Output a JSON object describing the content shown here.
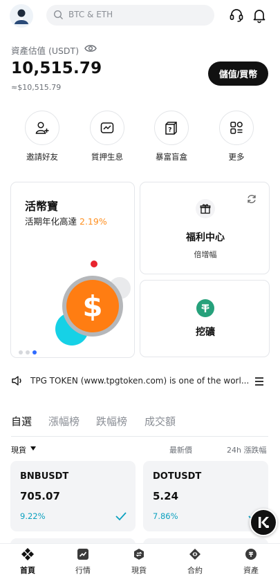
{
  "header": {
    "search_placeholder": "BTC & ETH"
  },
  "assets": {
    "label": "資產估值 (USDT)",
    "value": "10,515.79",
    "sub_value": "≈$10,515.79",
    "deposit_button": "儲值/買幣"
  },
  "shortcuts": [
    {
      "label": "邀請好友",
      "icon": "invite-user-icon"
    },
    {
      "label": "質押生息",
      "icon": "staking-icon"
    },
    {
      "label": "暴富盲盒",
      "icon": "blind-box-icon"
    },
    {
      "label": "更多",
      "icon": "more-grid-icon"
    }
  ],
  "earn_card": {
    "title": "活幣寶",
    "subtitle_prefix": "活期年化高達",
    "rate": "2.19%"
  },
  "welfare_card": {
    "title": "福利中心",
    "subtitle": "倍增幅"
  },
  "mining_card": {
    "title": "挖礦"
  },
  "notice": {
    "text": "TPG TOKEN (www.tpgtoken.com) is one of the worl..."
  },
  "market_tabs": [
    "自選",
    "漲幅榜",
    "跌幅榜",
    "成交額"
  ],
  "market_header": {
    "type": "現貨",
    "latest_price": "最新價",
    "change_24h": "24h 漲跌幅"
  },
  "market_cards": [
    {
      "symbol": "BNBUSDT",
      "price": "705.07",
      "change": "9.22%"
    },
    {
      "symbol": "DOTUSDT",
      "price": "5.24",
      "change": "7.86%"
    }
  ],
  "bottom_nav": [
    {
      "label": "首頁",
      "icon": "home-icon"
    },
    {
      "label": "行情",
      "icon": "market-icon"
    },
    {
      "label": "現貨",
      "icon": "spot-icon"
    },
    {
      "label": "合約",
      "icon": "contract-icon"
    },
    {
      "label": "資產",
      "icon": "assets-icon"
    }
  ],
  "colors": {
    "accent_orange": "#ff8f1f",
    "up_teal": "#0aa0bf",
    "primary_dark": "#111111",
    "tether_green": "#26a17b"
  }
}
